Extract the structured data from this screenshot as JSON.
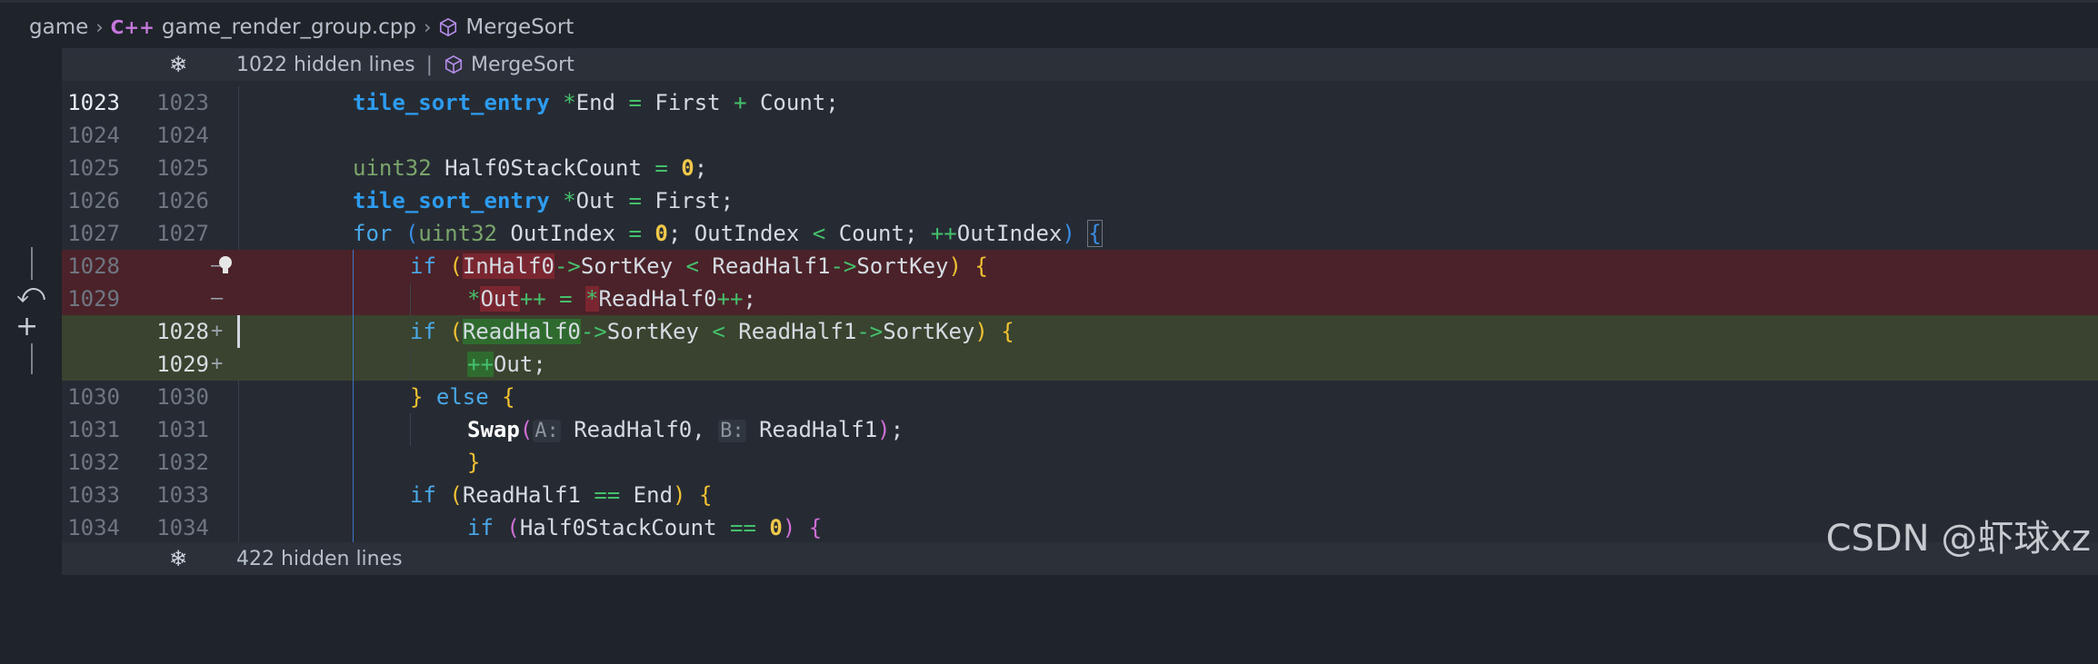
{
  "breadcrumb": {
    "items": [
      "game",
      "game_render_group.cpp",
      "MergeSort"
    ],
    "file_icon": "C++"
  },
  "fold_top": {
    "label": "1022 hidden lines",
    "symbol": "MergeSort"
  },
  "fold_bottom": {
    "label": "422 hidden lines"
  },
  "lines": [
    {
      "l": "1023",
      "r": "1023"
    },
    {
      "l": "1024",
      "r": "1024"
    },
    {
      "l": "1025",
      "r": "1025"
    },
    {
      "l": "1026",
      "r": "1026"
    },
    {
      "l": "1027",
      "r": "1027"
    },
    {
      "l": "1028",
      "r": ""
    },
    {
      "l": "1029",
      "r": ""
    },
    {
      "l": "",
      "r": "1028"
    },
    {
      "l": "",
      "r": "1029"
    },
    {
      "l": "1030",
      "r": "1030"
    },
    {
      "l": "1031",
      "r": "1031"
    },
    {
      "l": "1032",
      "r": "1032"
    },
    {
      "l": "1033",
      "r": "1033"
    },
    {
      "l": "1034",
      "r": "1034"
    }
  ],
  "code": {
    "tile_sort_entry": "tile_sort_entry",
    "end": "End",
    "first": "First",
    "count": "Count",
    "uint32": "uint32",
    "half0stackcount": "Half0StackCount",
    "out": "Out",
    "for": "for",
    "outindex": "OutIndex",
    "if": "if",
    "else": "else",
    "inhalf0": "InHalf0",
    "readhalf0": "ReadHalf0",
    "readhalf1": "ReadHalf1",
    "sortkey": "SortKey",
    "swap": "Swap",
    "hint_a": "A:",
    "hint_b": "B:",
    "zero": "0"
  },
  "watermark": "CSDN @虾球xz",
  "colors": {
    "removed_bg": "#4b2229",
    "added_bg": "#39432f",
    "keyword": "#4aa8e8",
    "operator": "#44c06b",
    "number": "#f0c84a"
  }
}
